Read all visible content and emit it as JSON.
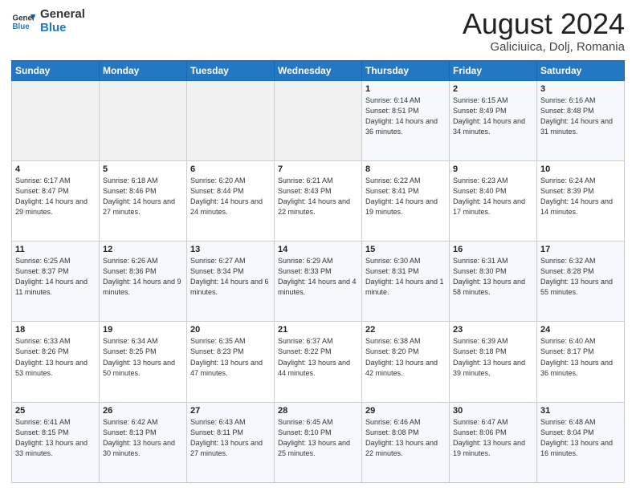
{
  "logo": {
    "line1": "General",
    "line2": "Blue"
  },
  "title": "August 2024",
  "subtitle": "Galiciuica, Dolj, Romania",
  "weekdays": [
    "Sunday",
    "Monday",
    "Tuesday",
    "Wednesday",
    "Thursday",
    "Friday",
    "Saturday"
  ],
  "weeks": [
    [
      {
        "day": "",
        "info": ""
      },
      {
        "day": "",
        "info": ""
      },
      {
        "day": "",
        "info": ""
      },
      {
        "day": "",
        "info": ""
      },
      {
        "day": "1",
        "info": "Sunrise: 6:14 AM\nSunset: 8:51 PM\nDaylight: 14 hours and 36 minutes."
      },
      {
        "day": "2",
        "info": "Sunrise: 6:15 AM\nSunset: 8:49 PM\nDaylight: 14 hours and 34 minutes."
      },
      {
        "day": "3",
        "info": "Sunrise: 6:16 AM\nSunset: 8:48 PM\nDaylight: 14 hours and 31 minutes."
      }
    ],
    [
      {
        "day": "4",
        "info": "Sunrise: 6:17 AM\nSunset: 8:47 PM\nDaylight: 14 hours and 29 minutes."
      },
      {
        "day": "5",
        "info": "Sunrise: 6:18 AM\nSunset: 8:46 PM\nDaylight: 14 hours and 27 minutes."
      },
      {
        "day": "6",
        "info": "Sunrise: 6:20 AM\nSunset: 8:44 PM\nDaylight: 14 hours and 24 minutes."
      },
      {
        "day": "7",
        "info": "Sunrise: 6:21 AM\nSunset: 8:43 PM\nDaylight: 14 hours and 22 minutes."
      },
      {
        "day": "8",
        "info": "Sunrise: 6:22 AM\nSunset: 8:41 PM\nDaylight: 14 hours and 19 minutes."
      },
      {
        "day": "9",
        "info": "Sunrise: 6:23 AM\nSunset: 8:40 PM\nDaylight: 14 hours and 17 minutes."
      },
      {
        "day": "10",
        "info": "Sunrise: 6:24 AM\nSunset: 8:39 PM\nDaylight: 14 hours and 14 minutes."
      }
    ],
    [
      {
        "day": "11",
        "info": "Sunrise: 6:25 AM\nSunset: 8:37 PM\nDaylight: 14 hours and 11 minutes."
      },
      {
        "day": "12",
        "info": "Sunrise: 6:26 AM\nSunset: 8:36 PM\nDaylight: 14 hours and 9 minutes."
      },
      {
        "day": "13",
        "info": "Sunrise: 6:27 AM\nSunset: 8:34 PM\nDaylight: 14 hours and 6 minutes."
      },
      {
        "day": "14",
        "info": "Sunrise: 6:29 AM\nSunset: 8:33 PM\nDaylight: 14 hours and 4 minutes."
      },
      {
        "day": "15",
        "info": "Sunrise: 6:30 AM\nSunset: 8:31 PM\nDaylight: 14 hours and 1 minute."
      },
      {
        "day": "16",
        "info": "Sunrise: 6:31 AM\nSunset: 8:30 PM\nDaylight: 13 hours and 58 minutes."
      },
      {
        "day": "17",
        "info": "Sunrise: 6:32 AM\nSunset: 8:28 PM\nDaylight: 13 hours and 55 minutes."
      }
    ],
    [
      {
        "day": "18",
        "info": "Sunrise: 6:33 AM\nSunset: 8:26 PM\nDaylight: 13 hours and 53 minutes."
      },
      {
        "day": "19",
        "info": "Sunrise: 6:34 AM\nSunset: 8:25 PM\nDaylight: 13 hours and 50 minutes."
      },
      {
        "day": "20",
        "info": "Sunrise: 6:35 AM\nSunset: 8:23 PM\nDaylight: 13 hours and 47 minutes."
      },
      {
        "day": "21",
        "info": "Sunrise: 6:37 AM\nSunset: 8:22 PM\nDaylight: 13 hours and 44 minutes."
      },
      {
        "day": "22",
        "info": "Sunrise: 6:38 AM\nSunset: 8:20 PM\nDaylight: 13 hours and 42 minutes."
      },
      {
        "day": "23",
        "info": "Sunrise: 6:39 AM\nSunset: 8:18 PM\nDaylight: 13 hours and 39 minutes."
      },
      {
        "day": "24",
        "info": "Sunrise: 6:40 AM\nSunset: 8:17 PM\nDaylight: 13 hours and 36 minutes."
      }
    ],
    [
      {
        "day": "25",
        "info": "Sunrise: 6:41 AM\nSunset: 8:15 PM\nDaylight: 13 hours and 33 minutes."
      },
      {
        "day": "26",
        "info": "Sunrise: 6:42 AM\nSunset: 8:13 PM\nDaylight: 13 hours and 30 minutes."
      },
      {
        "day": "27",
        "info": "Sunrise: 6:43 AM\nSunset: 8:11 PM\nDaylight: 13 hours and 27 minutes."
      },
      {
        "day": "28",
        "info": "Sunrise: 6:45 AM\nSunset: 8:10 PM\nDaylight: 13 hours and 25 minutes."
      },
      {
        "day": "29",
        "info": "Sunrise: 6:46 AM\nSunset: 8:08 PM\nDaylight: 13 hours and 22 minutes."
      },
      {
        "day": "30",
        "info": "Sunrise: 6:47 AM\nSunset: 8:06 PM\nDaylight: 13 hours and 19 minutes."
      },
      {
        "day": "31",
        "info": "Sunrise: 6:48 AM\nSunset: 8:04 PM\nDaylight: 13 hours and 16 minutes."
      }
    ]
  ]
}
